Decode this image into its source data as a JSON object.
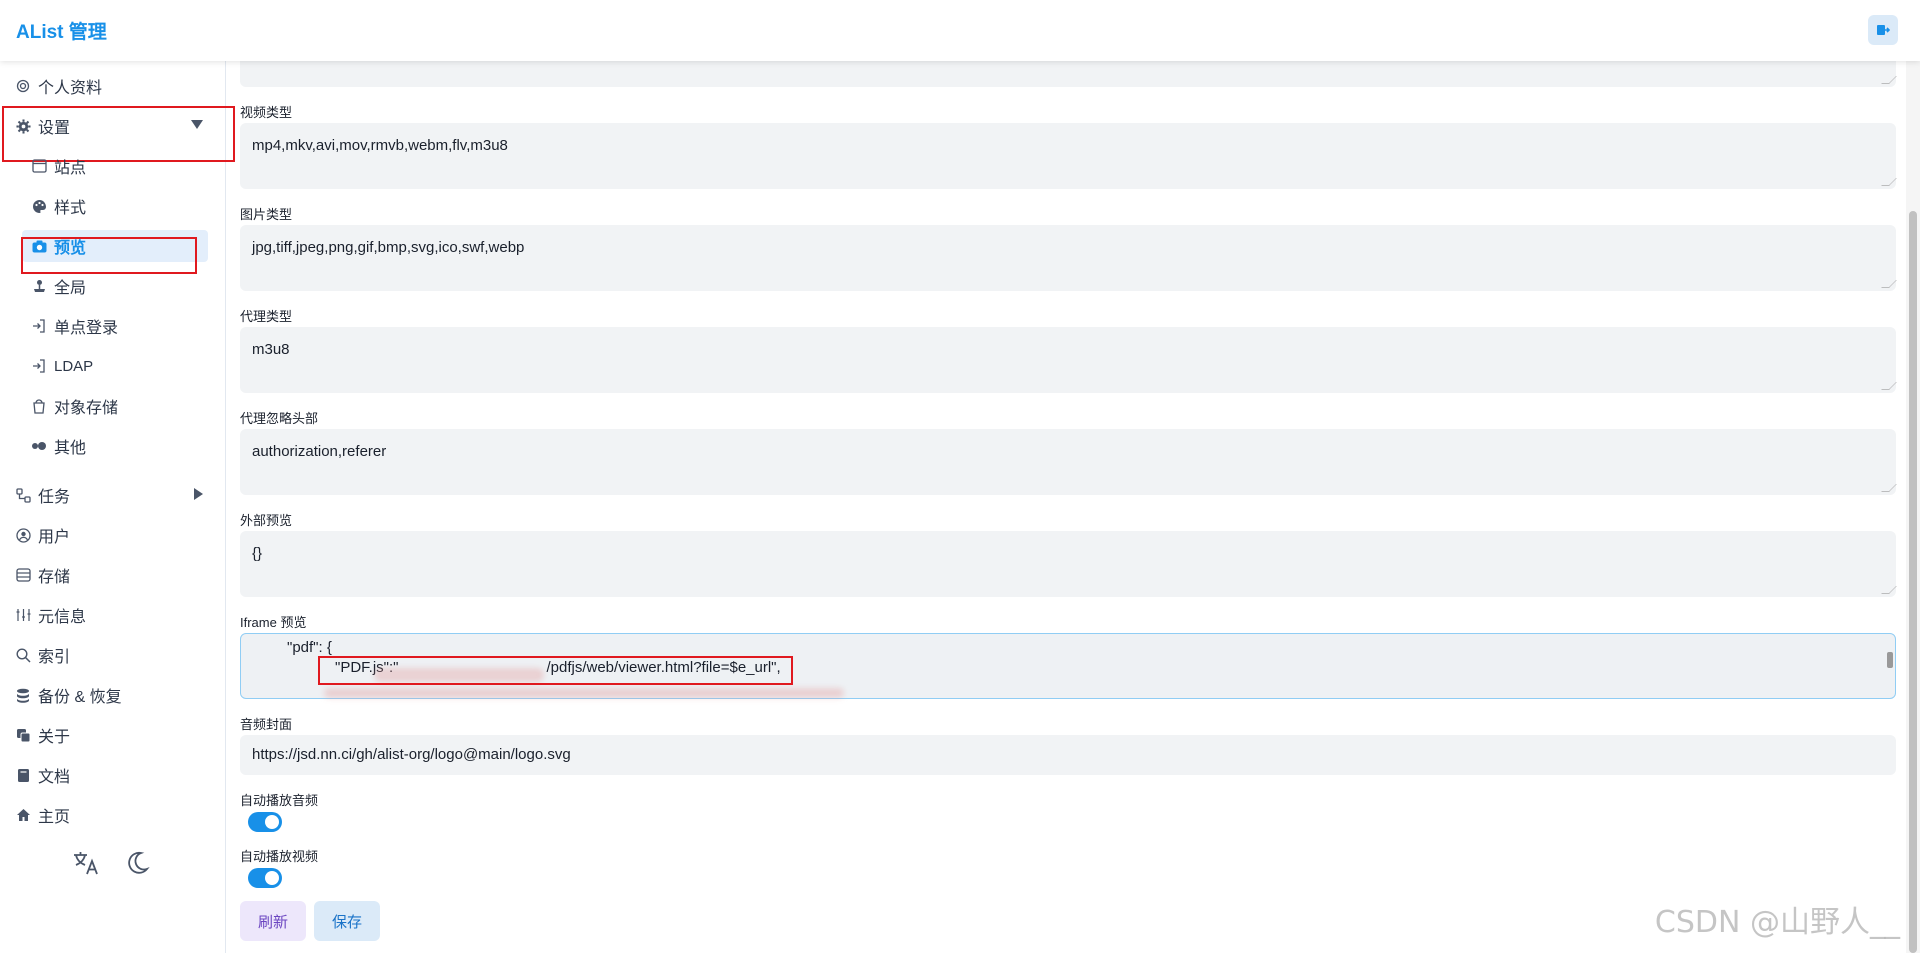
{
  "app": {
    "title": "AList 管理"
  },
  "sidebar": {
    "profile": "个人资料",
    "settings": "设置",
    "settings_children": {
      "site": "站点",
      "style": "样式",
      "preview": "预览",
      "global": "全局",
      "sso": "单点登录",
      "ldap": "LDAP",
      "s3": "对象存储",
      "other": "其他"
    },
    "tasks": "任务",
    "users": "用户",
    "storage": "存储",
    "meta": "元信息",
    "index": "索引",
    "backup": "备份 & 恢复",
    "about": "关于",
    "docs": "文档",
    "home": "主页"
  },
  "fields": {
    "video_types": {
      "label": "视频类型",
      "value": "mp4,mkv,avi,mov,rmvb,webm,flv,m3u8"
    },
    "image_types": {
      "label": "图片类型",
      "value": "jpg,tiff,jpeg,png,gif,bmp,svg,ico,swf,webp"
    },
    "proxy_types": {
      "label": "代理类型",
      "value": "m3u8"
    },
    "proxy_ignore_headers": {
      "label": "代理忽略头部",
      "value": "authorization,referer"
    },
    "external_previews": {
      "label": "外部预览",
      "value": "{}"
    },
    "iframe_previews": {
      "label": "Iframe 预览",
      "line1": "\"pdf\": {",
      "line2_key": "\"PDF.js\":\"",
      "line2_value": "/pdfjs/web/viewer.html?file=$e_url\","
    },
    "audio_cover": {
      "label": "音频封面",
      "value": "https://jsd.nn.ci/gh/alist-org/logo@main/logo.svg"
    },
    "auto_play_audio": {
      "label": "自动播放音频",
      "on": true
    },
    "auto_play_video": {
      "label": "自动播放视频",
      "on": true
    }
  },
  "buttons": {
    "refresh": "刷新",
    "save": "保存"
  },
  "watermark": "CSDN @山野人__",
  "colors": {
    "accent": "#1890e8",
    "highlight_box": "#e0191f"
  }
}
